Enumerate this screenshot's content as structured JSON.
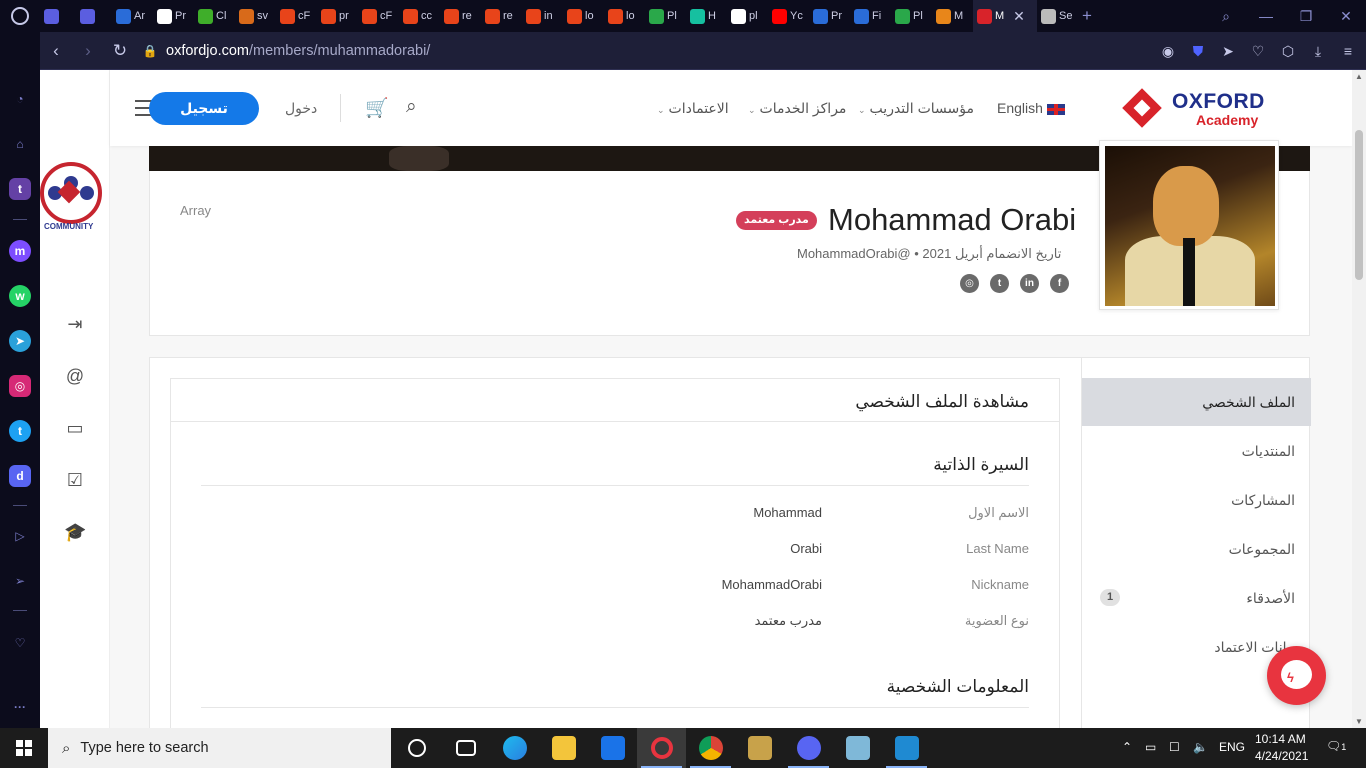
{
  "browser": {
    "tabs": [
      {
        "label": "",
        "color": "#5b5ee0"
      },
      {
        "label": "",
        "color": "#5b5ee0"
      },
      {
        "label": "Ar",
        "color": "#2a6cd8"
      },
      {
        "label": "Pr",
        "color": "#ffffff"
      },
      {
        "label": "Cl",
        "color": "#3fae2a"
      },
      {
        "label": "sv",
        "color": "#d86a1a"
      },
      {
        "label": "cF",
        "color": "#e8441a"
      },
      {
        "label": "pr",
        "color": "#e8441a"
      },
      {
        "label": "cF",
        "color": "#e8441a"
      },
      {
        "label": "cc",
        "color": "#e8441a"
      },
      {
        "label": "re",
        "color": "#e8441a"
      },
      {
        "label": "re",
        "color": "#e8441a"
      },
      {
        "label": "in",
        "color": "#e8441a"
      },
      {
        "label": "lo",
        "color": "#e8441a"
      },
      {
        "label": "lo",
        "color": "#e8441a"
      },
      {
        "label": "Pl",
        "color": "#2aa84a"
      },
      {
        "label": "H",
        "color": "#16c0a0"
      },
      {
        "label": "pl",
        "color": "#ffffff"
      },
      {
        "label": "Yc",
        "color": "#ff0000"
      },
      {
        "label": "Pr",
        "color": "#2a6cd8"
      },
      {
        "label": "Fi",
        "color": "#2a6cd8"
      },
      {
        "label": "Pl",
        "color": "#2aa84a"
      },
      {
        "label": "M",
        "color": "#e8861a"
      },
      {
        "label": "M",
        "color": "#d8232a",
        "active": true
      },
      {
        "label": "Se",
        "color": "#bbbbbb"
      }
    ],
    "url_host": "oxfordjo.com",
    "url_path": "/members/muhammadorabi/"
  },
  "site": {
    "logo_line1": "OXFORD",
    "logo_line2": "Academy",
    "community_label": "COMMUNITY",
    "signup_label": "تسجيل",
    "login_label": "دخول",
    "language_label": "English",
    "menu": [
      "مؤسسات التدريب",
      "مراكز الخدمات",
      "الاعتمادات"
    ]
  },
  "profile": {
    "name": "Mohammad Orabi",
    "badge": "مدرب معتمد",
    "meta": "MohammadOrabi@ • تاريخ الانضمام أبريل 2021",
    "array_text": "Array",
    "social": [
      "instagram",
      "twitter",
      "linkedin",
      "facebook"
    ]
  },
  "tabs": [
    {
      "label": "الملف الشخصي",
      "active": true
    },
    {
      "label": "المنتديات"
    },
    {
      "label": "المشاركات"
    },
    {
      "label": "المجموعات"
    },
    {
      "label": "الأصدقاء",
      "count": "1"
    },
    {
      "label": "بيانات الاعتماد"
    }
  ],
  "panel": {
    "title": "مشاهدة الملف الشخصي",
    "section1": "السيرة الذاتية",
    "fields": [
      {
        "label": "الاسم الاول",
        "value": "Mohammad"
      },
      {
        "label": "Last Name",
        "value": "Orabi"
      },
      {
        "label": "Nickname",
        "value": "MohammadOrabi"
      },
      {
        "label": "نوع العضوية",
        "value": "مدرب معتمد"
      }
    ],
    "section2": "المعلومات الشخصية"
  },
  "taskbar": {
    "search_placeholder": "Type here to search",
    "language": "ENG",
    "time": "10:14 AM",
    "date": "4/24/2021",
    "notification_count": "1"
  }
}
